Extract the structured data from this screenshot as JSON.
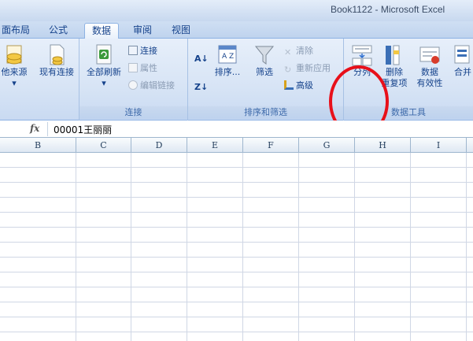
{
  "window": {
    "title": "Book1122 - Microsoft Excel"
  },
  "tabs": [
    {
      "label": "面布局",
      "active": false
    },
    {
      "label": "公式",
      "active": false
    },
    {
      "label": "数据",
      "active": true
    },
    {
      "label": "审阅",
      "active": false
    },
    {
      "label": "视图",
      "active": false
    }
  ],
  "ribbon": {
    "get_external": {
      "other_sources": "他来源",
      "existing_connections": "现有连接"
    },
    "connections": {
      "refresh_all": "全部刷新",
      "connections": "连接",
      "properties": "属性",
      "edit_links": "编辑链接",
      "group_label": "连接"
    },
    "sort_filter": {
      "sort": "排序...",
      "filter": "筛选",
      "clear": "清除",
      "reapply": "重新应用",
      "advanced": "高级",
      "group_label": "排序和筛选"
    },
    "data_tools": {
      "text_to_columns": "分列",
      "remove_duplicates_1": "删除",
      "remove_duplicates_2": "重复项",
      "data_validation_1": "数据",
      "data_validation_2": "有效性",
      "consolidate": "合并",
      "group_label": "数据工具"
    }
  },
  "formula_bar": {
    "fx": "fx",
    "value": "00001王丽丽"
  },
  "columns": [
    "B",
    "C",
    "D",
    "E",
    "F",
    "G",
    "H",
    "I"
  ],
  "colors": {
    "annotation": "#e8101a",
    "ribbon": "#d7e4f5",
    "accent": "#15428b"
  }
}
